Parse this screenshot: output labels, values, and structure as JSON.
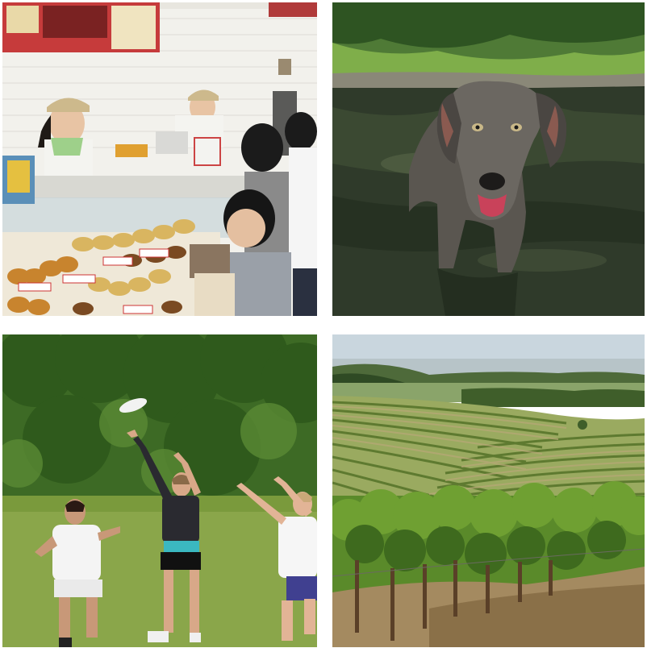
{
  "images": [
    {
      "name": "donut-shop",
      "description_icon": "photo-icon"
    },
    {
      "name": "dog-in-water",
      "description_icon": "photo-icon"
    },
    {
      "name": "frisbee-game",
      "description_icon": "photo-icon"
    },
    {
      "name": "vineyard",
      "description_icon": "photo-icon"
    }
  ],
  "colors": {
    "background": "#ffffff",
    "water": "#2f3a2a",
    "grass": "#8aa64a",
    "trees": "#3d6a25",
    "sky": "#c9d6de",
    "tile_wall": "#f2f2ee"
  }
}
